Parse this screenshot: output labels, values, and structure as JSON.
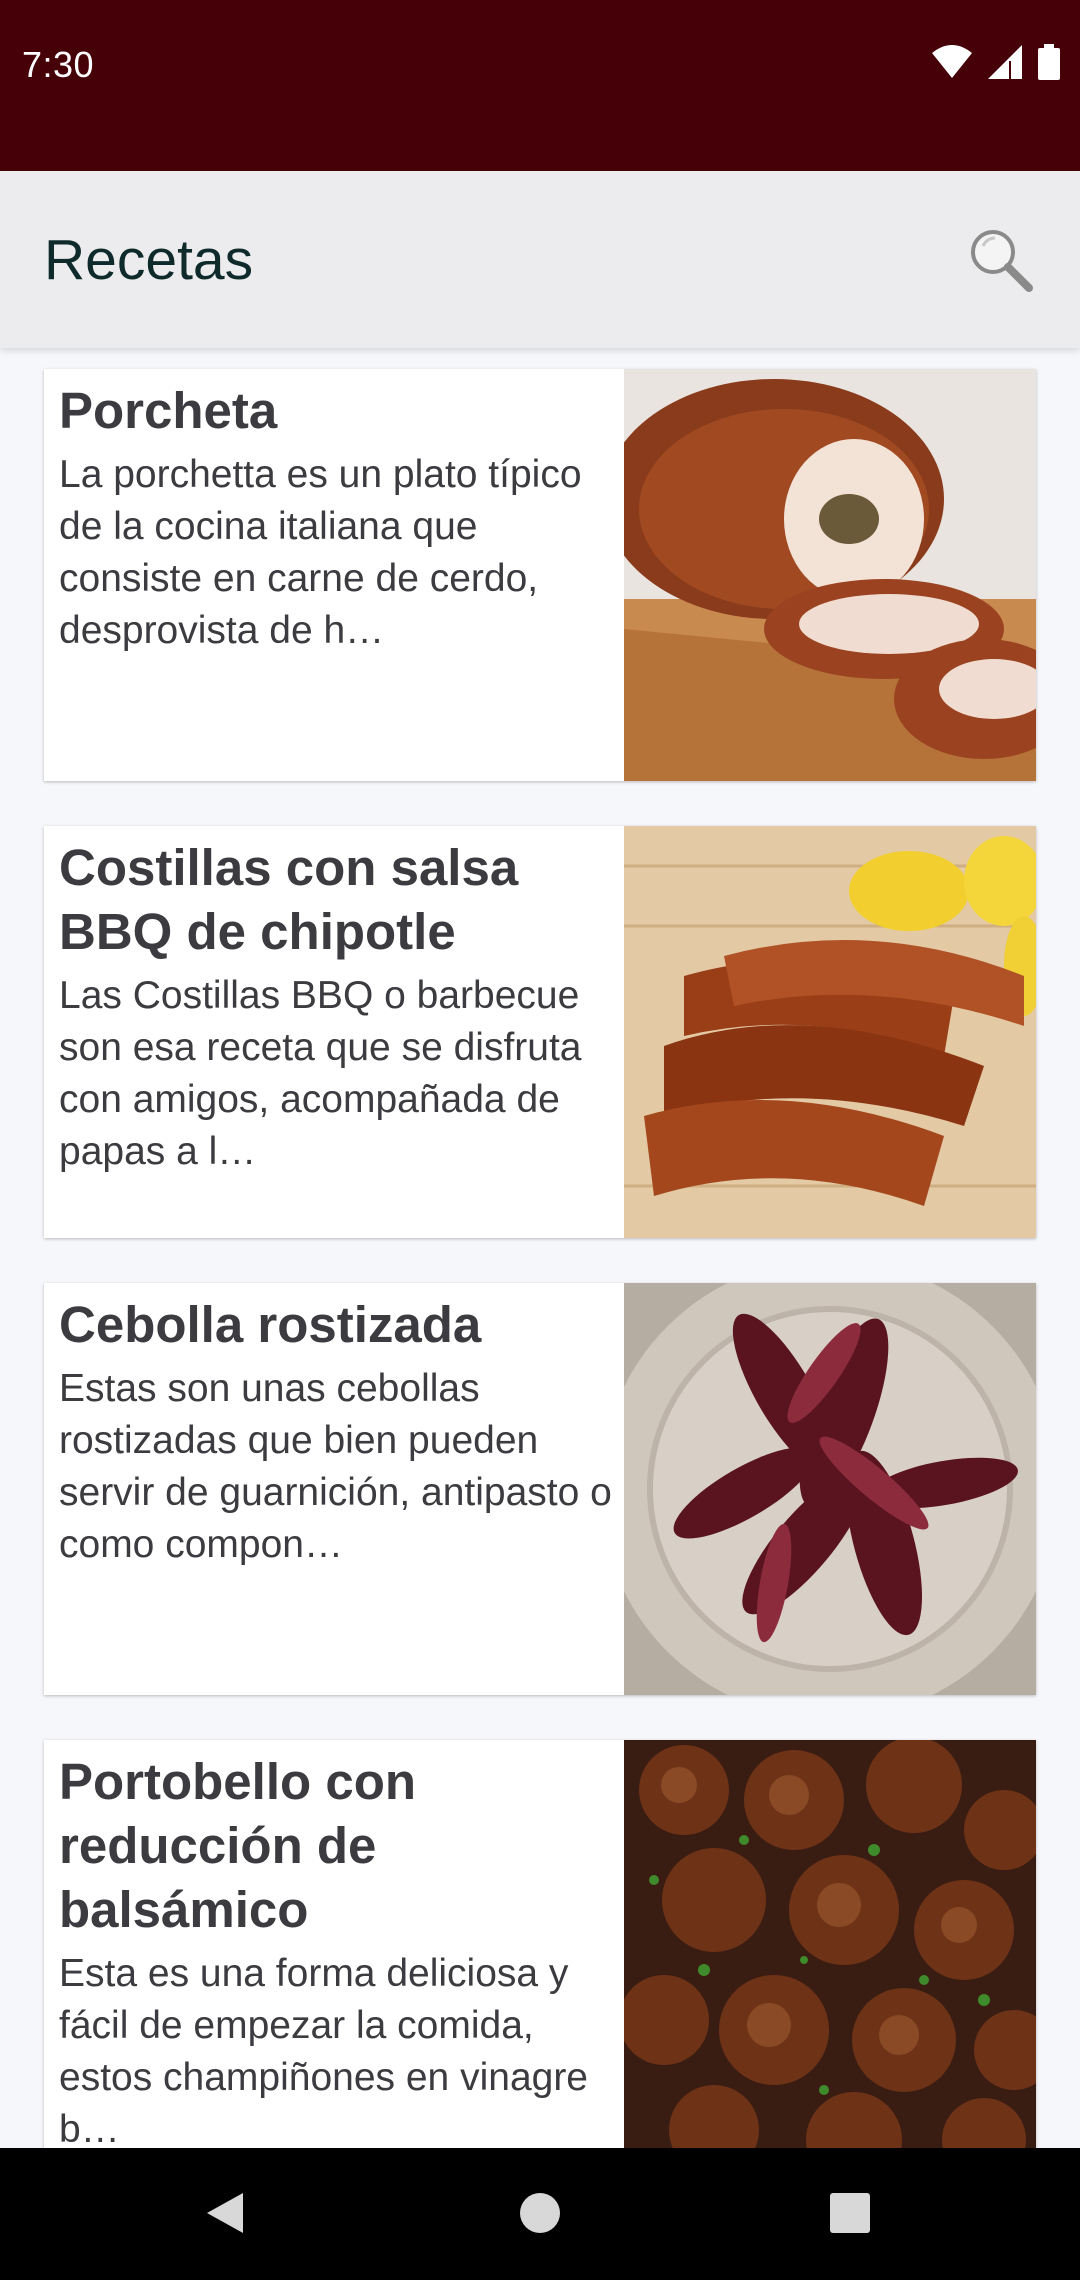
{
  "status_bar": {
    "time": "7:30",
    "icons": [
      "wifi-icon",
      "cell-signal-icon",
      "battery-icon"
    ]
  },
  "app_bar": {
    "title": "Recetas",
    "search_icon": "search-icon"
  },
  "recipes": [
    {
      "title": "Porcheta",
      "description": "La porchetta es un plato típico de la cocina italiana que consiste en carne de cerdo, desprovista de h…",
      "image": "porchetta-photo"
    },
    {
      "title": "Costillas con salsa BBQ de chipotle",
      "description": "Las Costillas BBQ o barbecue son esa receta que se disfruta con amigos, acompañada de papas a l…",
      "image": "bbq-ribs-photo"
    },
    {
      "title": "Cebolla rostizada",
      "description": "Estas son unas cebollas rostizadas que bien pueden servir de guarnición, antipasto o como compon…",
      "image": "roasted-onion-photo"
    },
    {
      "title": "Portobello con reducción de balsámico",
      "description": "Esta es una forma deliciosa y fácil de empezar la comida, estos champiñones en vinagre b…",
      "image": "portobello-photo"
    }
  ],
  "nav_bar": {
    "icons": [
      "back-icon",
      "home-icon",
      "recents-icon"
    ]
  },
  "colors": {
    "status_bar": "#460007",
    "app_bar": "#ececee",
    "text": "#3b3b40"
  }
}
